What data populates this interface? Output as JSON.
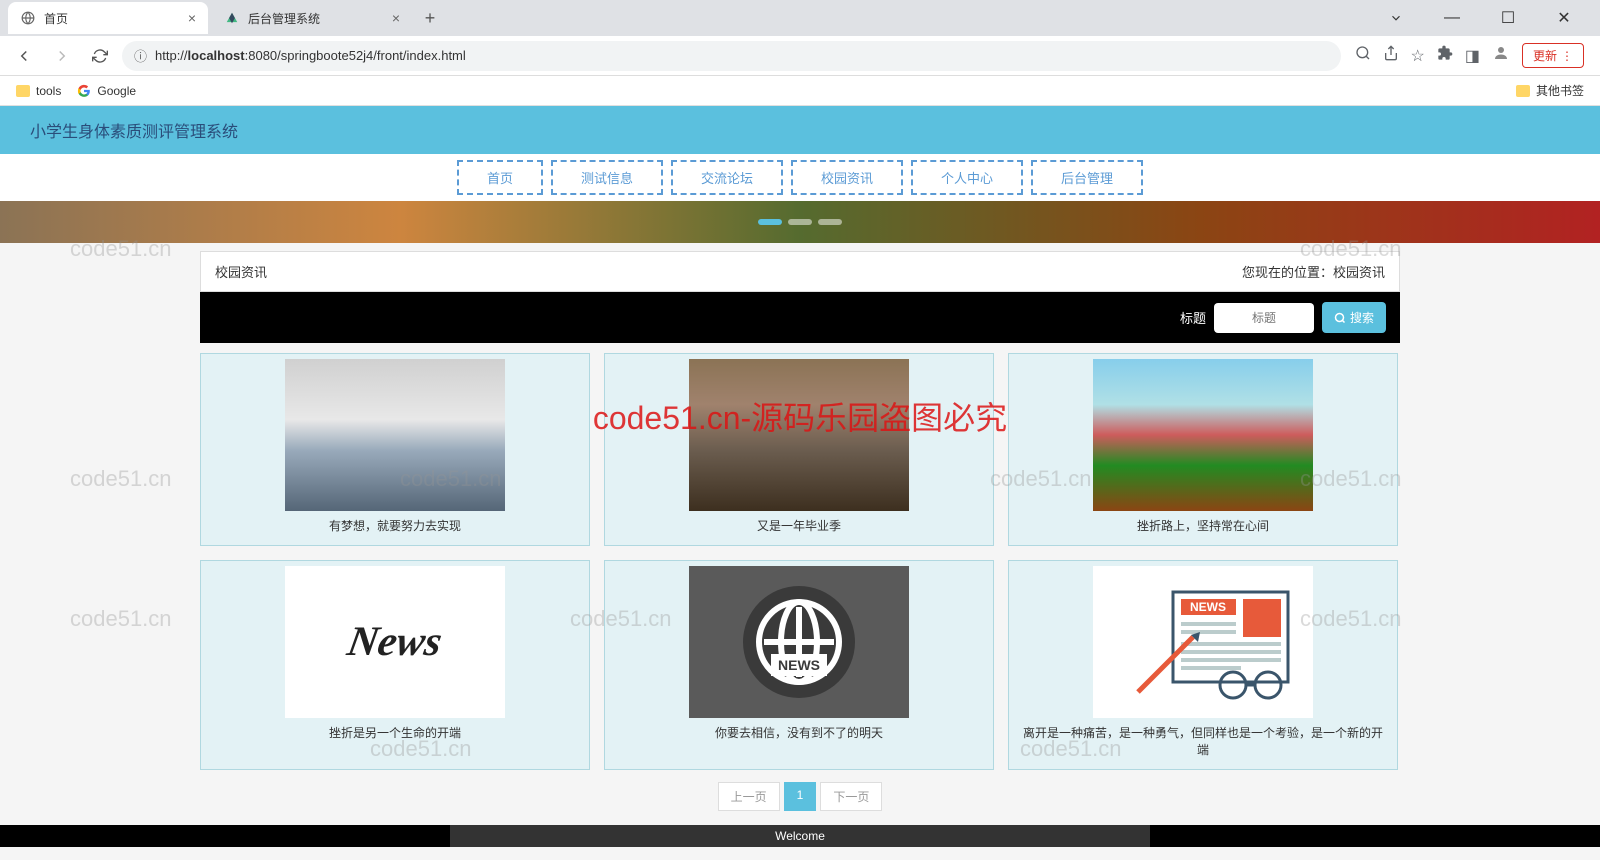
{
  "browser": {
    "tabs": [
      {
        "title": "首页",
        "active": true
      },
      {
        "title": "后台管理系统",
        "active": false
      }
    ],
    "url_display": "http://localhost:8080/springboote52j4/front/index.html",
    "url_host": "localhost",
    "update_label": "更新",
    "bookmarks": [
      {
        "label": "tools",
        "type": "folder"
      },
      {
        "label": "Google",
        "type": "google"
      }
    ],
    "other_bookmarks": "其他书签"
  },
  "site": {
    "title": "小学生身体素质测评管理系统",
    "nav": [
      "首页",
      "测试信息",
      "交流论坛",
      "校园资讯",
      "个人中心",
      "后台管理"
    ]
  },
  "breadcrumb": {
    "title": "校园资讯",
    "location_label": "您现在的位置：",
    "location_value": "校园资讯"
  },
  "search": {
    "label": "标题",
    "placeholder": "标题",
    "button": "搜索"
  },
  "cards": [
    {
      "title": "有梦想，就要努力去实现",
      "imgClass": "img-school"
    },
    {
      "title": "又是一年毕业季",
      "imgClass": "img-class"
    },
    {
      "title": "挫折路上，坚持常在心间",
      "imgClass": "img-field"
    },
    {
      "title": "挫折是另一个生命的开端",
      "imgClass": "img-news1"
    },
    {
      "title": "你要去相信，没有到不了的明天",
      "imgClass": "img-news2"
    },
    {
      "title": "离开是一种痛苦，是一种勇气，但同样也是一个考验，是一个新的开端",
      "imgClass": "img-news3"
    }
  ],
  "pagination": {
    "prev": "上一页",
    "pages": [
      "1"
    ],
    "next": "下一页",
    "active": "1"
  },
  "footer": "Welcome",
  "watermark": {
    "small": "code51.cn",
    "big": "code51.cn-源码乐园盗图必究"
  }
}
